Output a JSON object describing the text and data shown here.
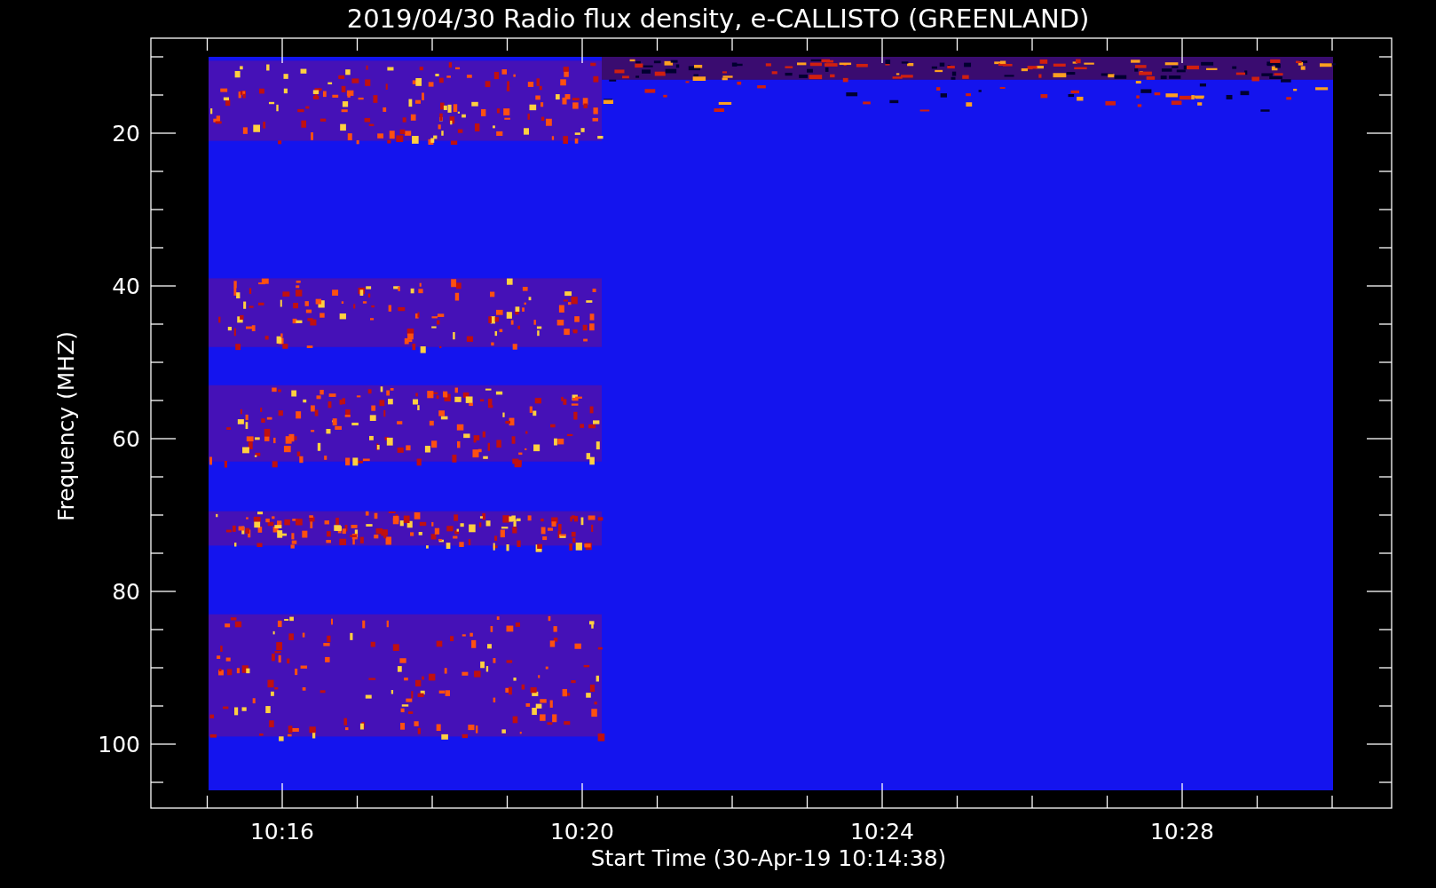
{
  "title": "2019/04/30  Radio flux density, e-CALLISTO (GREENLAND)",
  "y_axis": {
    "label": "Frequency (MHZ)",
    "ticks": [
      "20",
      "40",
      "60",
      "80",
      "100"
    ]
  },
  "x_axis": {
    "label": "Start Time (30-Apr-19 10:14:38)",
    "ticks": [
      "10:16",
      "10:20",
      "10:24",
      "10:28"
    ]
  }
}
